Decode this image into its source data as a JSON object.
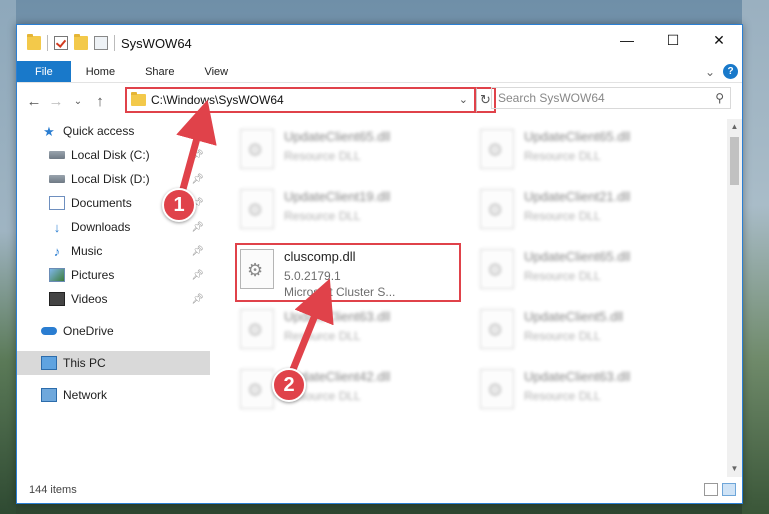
{
  "window": {
    "title": "SysWOW64"
  },
  "controls": {
    "minimize": "—",
    "maximize": "☐",
    "close": "✕"
  },
  "ribbon": {
    "tabs": [
      "File",
      "Home",
      "Share",
      "View"
    ],
    "expand": "⌄",
    "help": "?"
  },
  "nav": {
    "back": "←",
    "forward": "→",
    "recent": "⌄",
    "up": "↑"
  },
  "address": {
    "path": "C:\\Windows\\SysWOW64",
    "dropdown": "⌄",
    "refresh": "↻"
  },
  "search": {
    "placeholder": "Search SysWOW64",
    "icon": "⚲"
  },
  "sidebar": {
    "items": [
      {
        "label": "Quick access"
      },
      {
        "label": "Local Disk (C:)"
      },
      {
        "label": "Local Disk (D:)"
      },
      {
        "label": "Documents"
      },
      {
        "label": "Downloads"
      },
      {
        "label": "Music"
      },
      {
        "label": "Pictures"
      },
      {
        "label": "Videos"
      },
      {
        "label": "OneDrive"
      },
      {
        "label": "This PC"
      },
      {
        "label": "Network"
      }
    ]
  },
  "files": [
    {
      "name": "UpdateClient65.dll",
      "sub1": "Resource DLL"
    },
    {
      "name": "UpdateClient65.dll",
      "sub1": "Resource DLL"
    },
    {
      "name": "UpdateClient19.dll",
      "sub1": "Resource DLL"
    },
    {
      "name": "UpdateClient21.dll",
      "sub1": "Resource DLL"
    },
    {
      "name": "cluscomp.dll",
      "sub1": "5.0.2179.1",
      "sub2": "Microsoft Cluster S..."
    },
    {
      "name": "UpdateClient65.dll",
      "sub1": "Resource DLL"
    },
    {
      "name": "UpdateClient63.dll",
      "sub1": "Resource DLL"
    },
    {
      "name": "UpdateClient5.dll",
      "sub1": "Resource DLL"
    },
    {
      "name": "UpdateClient42.dll",
      "sub1": "Resource DLL"
    },
    {
      "name": "UpdateClient63.dll",
      "sub1": "Resource DLL"
    }
  ],
  "status": {
    "count": "144 items"
  },
  "callouts": {
    "one": "1",
    "two": "2"
  },
  "colors": {
    "accent": "#1979ca",
    "annotation": "#e0424a"
  }
}
